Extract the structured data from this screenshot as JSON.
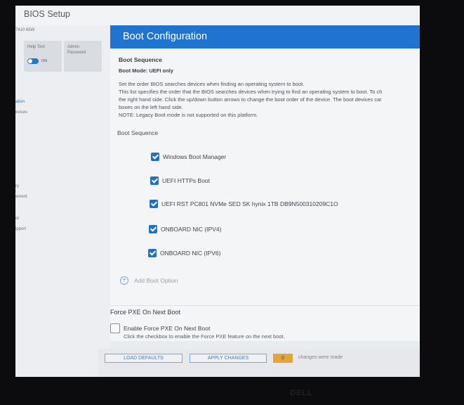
{
  "app": {
    "title": "BIOS Setup",
    "model": "7410 65W"
  },
  "quick_settings": {
    "help_text": {
      "label": "Help Text",
      "state": "ON"
    },
    "admin_password": {
      "label": "Admin Password"
    }
  },
  "sidebar": {
    "items": [
      {
        "label": "ation",
        "active": true
      },
      {
        "label": "evices",
        "active": false
      },
      {
        "label": "ry",
        "active": false
      },
      {
        "label": "ement",
        "active": false
      },
      {
        "label": "or",
        "active": false
      },
      {
        "label": "ipport",
        "active": false
      }
    ]
  },
  "panel": {
    "title": "Boot Configuration",
    "section_title": "Boot Sequence",
    "boot_mode": "Boot Mode: UEFI only",
    "description_lines": [
      "Set the order BIOS searches devices when finding an operating system to boot.",
      "This list specifies the order that the BIOS searches devices when trying to find an operating system to boot.  To ch",
      "the right hand side.  Click the up/down button arrows to change the boot order of the device.  The boot devices car",
      "boxes on the left hand side.",
      "NOTE: Legacy Boot mode is not supported on this platform."
    ],
    "sequence_label": "Boot Sequence",
    "boot_options": [
      {
        "label": "Windows Boot Manager",
        "checked": true
      },
      {
        "label": "UEFI HTTPs Boot",
        "checked": true
      },
      {
        "label": "UEFI RST PC801 NVMe SED SK hynix 1TB DB9N500310209C1O",
        "checked": true
      },
      {
        "label": "ONBOARD NIC (IPV4)",
        "checked": true
      },
      {
        "label": "ONBOARD NIC (IPV6)",
        "checked": true
      }
    ],
    "add_boot_option": "Add Boot Option",
    "pxe": {
      "title": "Force PXE On Next Boot",
      "checkbox_label": "Enable Force PXE On Next Boot",
      "checked": false,
      "help": "Click the checkbox to enable the Force PXE feature on the next boot."
    }
  },
  "footer": {
    "load_defaults": "LOAD DEFAULTS",
    "apply_changes": "APPLY CHANGES",
    "change_count": "0",
    "changes_label": "changes were made"
  },
  "bezel": {
    "logo": "DELL"
  },
  "colors": {
    "accent": "#1f74d0",
    "warning": "#e7a33b"
  }
}
